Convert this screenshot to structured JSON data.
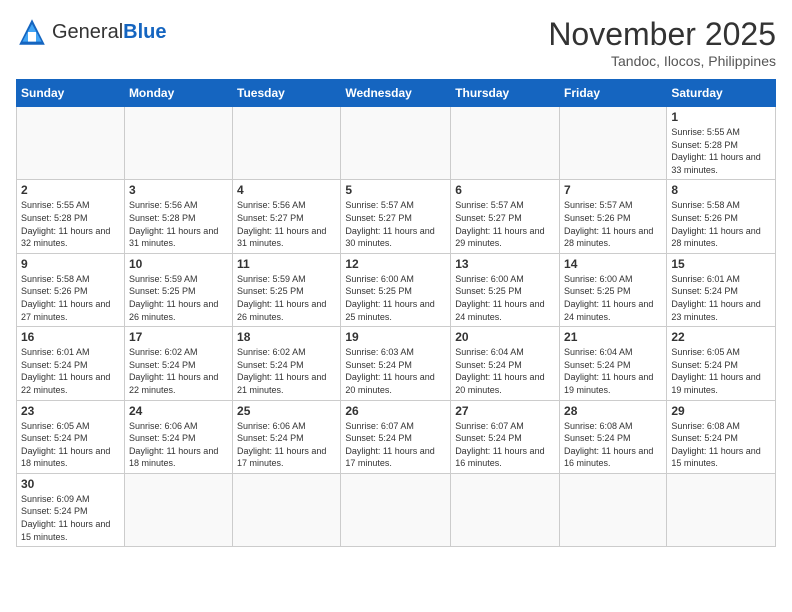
{
  "header": {
    "logo_general": "General",
    "logo_blue": "Blue",
    "month_title": "November 2025",
    "location": "Tandoc, Ilocos, Philippines"
  },
  "weekdays": [
    "Sunday",
    "Monday",
    "Tuesday",
    "Wednesday",
    "Thursday",
    "Friday",
    "Saturday"
  ],
  "days": {
    "1": {
      "sunrise": "5:55 AM",
      "sunset": "5:28 PM",
      "daylight": "11 hours and 33 minutes."
    },
    "2": {
      "sunrise": "5:55 AM",
      "sunset": "5:28 PM",
      "daylight": "11 hours and 32 minutes."
    },
    "3": {
      "sunrise": "5:56 AM",
      "sunset": "5:28 PM",
      "daylight": "11 hours and 31 minutes."
    },
    "4": {
      "sunrise": "5:56 AM",
      "sunset": "5:27 PM",
      "daylight": "11 hours and 31 minutes."
    },
    "5": {
      "sunrise": "5:57 AM",
      "sunset": "5:27 PM",
      "daylight": "11 hours and 30 minutes."
    },
    "6": {
      "sunrise": "5:57 AM",
      "sunset": "5:27 PM",
      "daylight": "11 hours and 29 minutes."
    },
    "7": {
      "sunrise": "5:57 AM",
      "sunset": "5:26 PM",
      "daylight": "11 hours and 28 minutes."
    },
    "8": {
      "sunrise": "5:58 AM",
      "sunset": "5:26 PM",
      "daylight": "11 hours and 28 minutes."
    },
    "9": {
      "sunrise": "5:58 AM",
      "sunset": "5:26 PM",
      "daylight": "11 hours and 27 minutes."
    },
    "10": {
      "sunrise": "5:59 AM",
      "sunset": "5:25 PM",
      "daylight": "11 hours and 26 minutes."
    },
    "11": {
      "sunrise": "5:59 AM",
      "sunset": "5:25 PM",
      "daylight": "11 hours and 26 minutes."
    },
    "12": {
      "sunrise": "6:00 AM",
      "sunset": "5:25 PM",
      "daylight": "11 hours and 25 minutes."
    },
    "13": {
      "sunrise": "6:00 AM",
      "sunset": "5:25 PM",
      "daylight": "11 hours and 24 minutes."
    },
    "14": {
      "sunrise": "6:00 AM",
      "sunset": "5:25 PM",
      "daylight": "11 hours and 24 minutes."
    },
    "15": {
      "sunrise": "6:01 AM",
      "sunset": "5:24 PM",
      "daylight": "11 hours and 23 minutes."
    },
    "16": {
      "sunrise": "6:01 AM",
      "sunset": "5:24 PM",
      "daylight": "11 hours and 22 minutes."
    },
    "17": {
      "sunrise": "6:02 AM",
      "sunset": "5:24 PM",
      "daylight": "11 hours and 22 minutes."
    },
    "18": {
      "sunrise": "6:02 AM",
      "sunset": "5:24 PM",
      "daylight": "11 hours and 21 minutes."
    },
    "19": {
      "sunrise": "6:03 AM",
      "sunset": "5:24 PM",
      "daylight": "11 hours and 20 minutes."
    },
    "20": {
      "sunrise": "6:04 AM",
      "sunset": "5:24 PM",
      "daylight": "11 hours and 20 minutes."
    },
    "21": {
      "sunrise": "6:04 AM",
      "sunset": "5:24 PM",
      "daylight": "11 hours and 19 minutes."
    },
    "22": {
      "sunrise": "6:05 AM",
      "sunset": "5:24 PM",
      "daylight": "11 hours and 19 minutes."
    },
    "23": {
      "sunrise": "6:05 AM",
      "sunset": "5:24 PM",
      "daylight": "11 hours and 18 minutes."
    },
    "24": {
      "sunrise": "6:06 AM",
      "sunset": "5:24 PM",
      "daylight": "11 hours and 18 minutes."
    },
    "25": {
      "sunrise": "6:06 AM",
      "sunset": "5:24 PM",
      "daylight": "11 hours and 17 minutes."
    },
    "26": {
      "sunrise": "6:07 AM",
      "sunset": "5:24 PM",
      "daylight": "11 hours and 17 minutes."
    },
    "27": {
      "sunrise": "6:07 AM",
      "sunset": "5:24 PM",
      "daylight": "11 hours and 16 minutes."
    },
    "28": {
      "sunrise": "6:08 AM",
      "sunset": "5:24 PM",
      "daylight": "11 hours and 16 minutes."
    },
    "29": {
      "sunrise": "6:08 AM",
      "sunset": "5:24 PM",
      "daylight": "11 hours and 15 minutes."
    },
    "30": {
      "sunrise": "6:09 AM",
      "sunset": "5:24 PM",
      "daylight": "11 hours and 15 minutes."
    }
  },
  "labels": {
    "sunrise": "Sunrise:",
    "sunset": "Sunset:",
    "daylight": "Daylight:"
  }
}
